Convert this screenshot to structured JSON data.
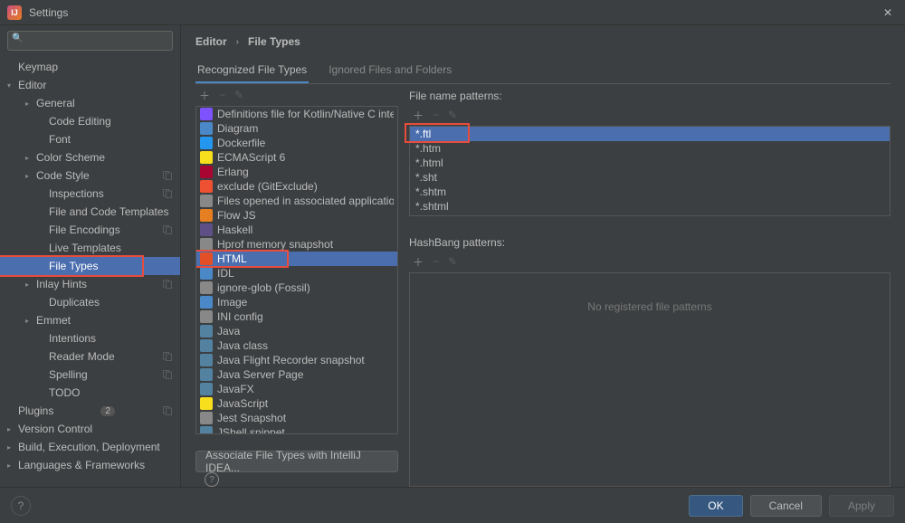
{
  "window": {
    "title": "Settings"
  },
  "sidebar": {
    "search_placeholder": "",
    "items": [
      {
        "label": "Keymap",
        "level": 0,
        "expandable": false
      },
      {
        "label": "Editor",
        "level": 0,
        "expandable": true,
        "expanded": true
      },
      {
        "label": "General",
        "level": 1,
        "expandable": true
      },
      {
        "label": "Code Editing",
        "level": 2
      },
      {
        "label": "Font",
        "level": 2
      },
      {
        "label": "Color Scheme",
        "level": 1,
        "expandable": true
      },
      {
        "label": "Code Style",
        "level": 1,
        "expandable": true,
        "dup": true
      },
      {
        "label": "Inspections",
        "level": 2,
        "dup": true
      },
      {
        "label": "File and Code Templates",
        "level": 2
      },
      {
        "label": "File Encodings",
        "level": 2,
        "dup": true
      },
      {
        "label": "Live Templates",
        "level": 2
      },
      {
        "label": "File Types",
        "level": 2,
        "selected": true,
        "highlight": true
      },
      {
        "label": "Inlay Hints",
        "level": 1,
        "expandable": true,
        "dup": true
      },
      {
        "label": "Duplicates",
        "level": 2
      },
      {
        "label": "Emmet",
        "level": 1,
        "expandable": true
      },
      {
        "label": "Intentions",
        "level": 2
      },
      {
        "label": "Reader Mode",
        "level": 2,
        "dup": true
      },
      {
        "label": "Spelling",
        "level": 2,
        "dup": true
      },
      {
        "label": "TODO",
        "level": 2
      },
      {
        "label": "Plugins",
        "level": 0,
        "badge": "2",
        "dup": true
      },
      {
        "label": "Version Control",
        "level": 0,
        "expandable": true
      },
      {
        "label": "Build, Execution, Deployment",
        "level": 0,
        "expandable": true
      },
      {
        "label": "Languages & Frameworks",
        "level": 0,
        "expandable": true
      }
    ]
  },
  "breadcrumb": {
    "root": "Editor",
    "leaf": "File Types"
  },
  "tabs": {
    "recognized": "Recognized File Types",
    "ignored": "Ignored Files and Folders"
  },
  "filetypes": [
    {
      "label": "Definitions file for Kotlin/Native C interop",
      "icon": "fi-kotlin"
    },
    {
      "label": "Diagram",
      "icon": "fi-diagram"
    },
    {
      "label": "Dockerfile",
      "icon": "fi-docker"
    },
    {
      "label": "ECMAScript 6",
      "icon": "fi-js"
    },
    {
      "label": "Erlang",
      "icon": "fi-erlang"
    },
    {
      "label": "exclude (GitExclude)",
      "icon": "fi-git"
    },
    {
      "label": "Files opened in associated applications",
      "icon": "fi-generic"
    },
    {
      "label": "Flow JS",
      "icon": "fi-flow"
    },
    {
      "label": "Haskell",
      "icon": "fi-haskell"
    },
    {
      "label": "Hprof memory snapshot",
      "icon": "fi-generic"
    },
    {
      "label": "HTML",
      "icon": "fi-html",
      "selected": true,
      "highlight": true
    },
    {
      "label": "IDL",
      "icon": "fi-idl"
    },
    {
      "label": "ignore-glob (Fossil)",
      "icon": "fi-generic"
    },
    {
      "label": "Image",
      "icon": "fi-image"
    },
    {
      "label": "INI config",
      "icon": "fi-ini"
    },
    {
      "label": "Java",
      "icon": "fi-java"
    },
    {
      "label": "Java class",
      "icon": "fi-java"
    },
    {
      "label": "Java Flight Recorder snapshot",
      "icon": "fi-java"
    },
    {
      "label": "Java Server Page",
      "icon": "fi-java"
    },
    {
      "label": "JavaFX",
      "icon": "fi-java"
    },
    {
      "label": "JavaScript",
      "icon": "fi-js"
    },
    {
      "label": "Jest Snapshot",
      "icon": "fi-json"
    },
    {
      "label": "JShell snippet",
      "icon": "fi-java"
    }
  ],
  "patterns": {
    "section_label": "File name patterns:",
    "items": [
      "*.ftl",
      "*.htm",
      "*.html",
      "*.sht",
      "*.shtm",
      "*.shtml"
    ],
    "selected_index": 0
  },
  "hashbang": {
    "section_label": "HashBang patterns:",
    "placeholder": "No registered file patterns"
  },
  "associate": {
    "label": "Associate File Types with IntelliJ IDEA..."
  },
  "footer": {
    "ok": "OK",
    "cancel": "Cancel",
    "apply": "Apply"
  }
}
